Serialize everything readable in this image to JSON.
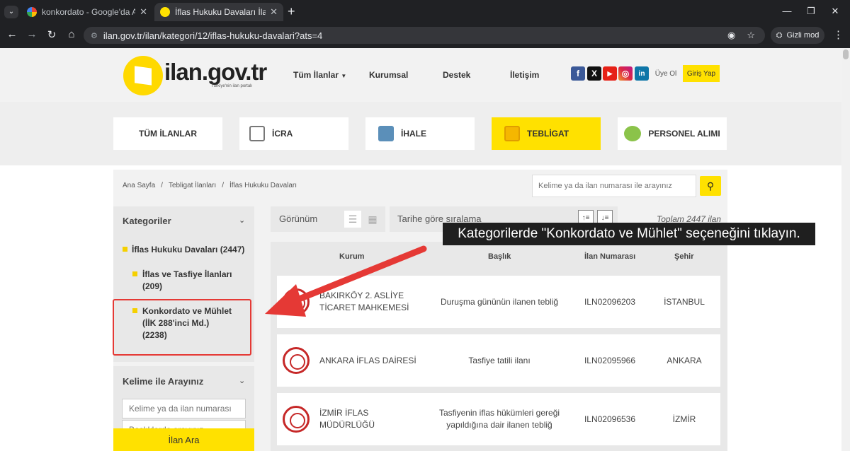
{
  "browser": {
    "tabs": [
      {
        "title": "konkordato - Google'da Ara",
        "active": false
      },
      {
        "title": "İflas Hukuku Davaları İlanları - İ",
        "active": true
      }
    ],
    "url": "ilan.gov.tr/ilan/kategori/12/iflas-hukuku-davalari?ats=4",
    "profile": "Gizli mod"
  },
  "header": {
    "logo_text": "ilan.gov.tr",
    "logo_tagline": "Türkiye'nin ilan portalı",
    "nav": [
      "Tüm İlanlar",
      "Kurumsal",
      "Destek",
      "İletişim"
    ],
    "social": [
      "f",
      "X",
      "▶",
      "◎",
      "in"
    ],
    "register": "Üye Ol",
    "login": "Giriş Yap"
  },
  "categories": [
    "TÜM İLANLAR",
    "İCRA",
    "İHALE",
    "TEBLİGAT",
    "PERSONEL ALIMI"
  ],
  "breadcrumb": [
    "Ana Sayfa",
    "Tebligat İlanları",
    "İflas Hukuku Davaları"
  ],
  "search": {
    "placeholder": "Kelime ya da ilan numarası ile arayınız"
  },
  "sidebar": {
    "title": "Kategoriler",
    "root": "İflas Hukuku Davaları (2447)",
    "children": [
      {
        "line1": "İflas ve Tasfiye İlanları",
        "line2": "(209)"
      },
      {
        "line1": "Konkordato ve Mühlet",
        "line2": "(İİK 288'inci Md.)",
        "line3": "(2238)"
      }
    ],
    "keyword_title": "Kelime ile Arayınız",
    "keyword_placeholder": "Kelime ya da ilan numarası",
    "keyword_placeholder2": "Başlıklarda arayınız",
    "search_button": "İlan Ara"
  },
  "toolbar": {
    "view_label": "Görünüm",
    "sort_label": "Tarihe göre sıralama",
    "total": "Toplam 2447 ilan"
  },
  "tooltip": "Kategorilerde \"Konkordato ve Mühlet\" seçeneğini tıklayın.",
  "table": {
    "headers": [
      "Kurum",
      "Başlık",
      "İlan Numarası",
      "Şehir"
    ],
    "rows": [
      {
        "kurum": "BAKIRKÖY 2. ASLİYE TİCARET MAHKEMESİ",
        "baslik": "Duruşma gününün ilanen tebliğ",
        "no": "ILN02096203",
        "sehir": "İSTANBUL"
      },
      {
        "kurum": "ANKARA İFLAS DAİRESİ",
        "baslik": "Tasfiye tatili ilanı",
        "no": "ILN02095966",
        "sehir": "ANKARA"
      },
      {
        "kurum": "İZMİR İFLAS MÜDÜRLÜĞÜ",
        "baslik": "Tasfiyenin iflas hükümleri gereği yapıldığına dair ilanen tebliğ",
        "no": "ILN02096536",
        "sehir": "İZMİR"
      }
    ]
  },
  "colors": {
    "accent": "#ffe100",
    "highlight": "#e53935",
    "tooltip_bg": "#1f1f1f"
  }
}
